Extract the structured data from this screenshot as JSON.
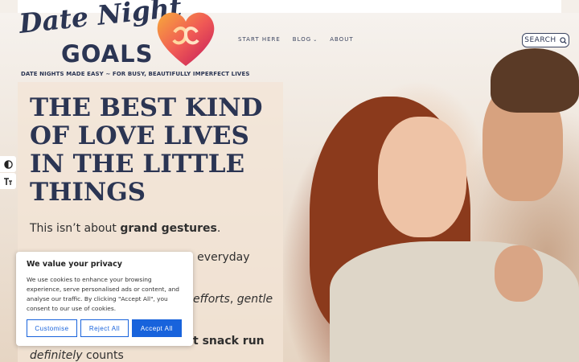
{
  "site": {
    "logo_line1": "Date Night",
    "logo_line2": "GOALS",
    "tagline": "DATE NIGHTS MADE EASY ~ FOR BUSY, BEAUTIFULLY IMPERFECT LIVES"
  },
  "nav": {
    "items": [
      {
        "label": "START HERE"
      },
      {
        "label": "BLOG"
      },
      {
        "label": "ABOUT"
      }
    ],
    "search_label": "SEARCH"
  },
  "hero": {
    "headline": "THE BEST KIND OF LOVE LIVES IN THE LITTLE THINGS",
    "line1_pre": "This isn’t about ",
    "line1_bold": "grand gestures",
    "line1_post": ".",
    "line2_tail": "y, everyday",
    "line3_italic_1": "efforts",
    "line3_mid": ", ",
    "line3_italic_2": "gentle",
    "line4_bold": "t snack run",
    "line5_italic": "definitely",
    "line5_post": " counts"
  },
  "cookie": {
    "title": "We value your privacy",
    "text": "We use cookies to enhance your browsing experience, serve personalised ads or content, and analyse our traffic. By clicking \"Accept All\", you consent to our use of cookies.",
    "customise": "Customise",
    "reject": "Reject All",
    "accept": "Accept All"
  },
  "colors": {
    "brand_navy": "#2b3553",
    "accept_blue": "#1863dc"
  },
  "icons": {
    "contrast": "contrast-icon",
    "text_size": "text-size-icon",
    "search": "search-icon",
    "heart": "heart-logo-icon"
  }
}
